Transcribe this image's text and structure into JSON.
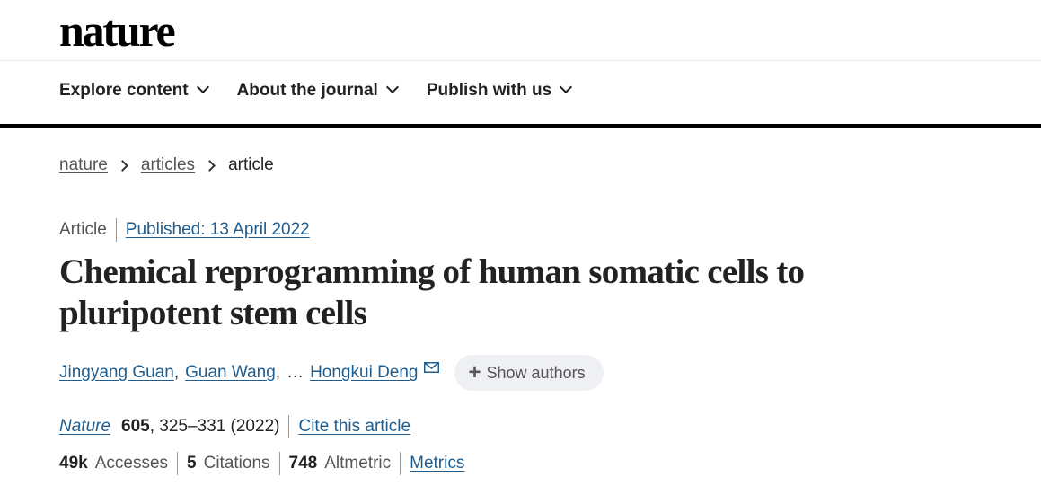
{
  "header": {
    "logo": "nature"
  },
  "nav": {
    "items": [
      {
        "label": "Explore content"
      },
      {
        "label": "About the journal"
      },
      {
        "label": "Publish with us"
      }
    ]
  },
  "breadcrumb": {
    "items": [
      "nature",
      "articles"
    ],
    "current": "article"
  },
  "article": {
    "type": "Article",
    "published": "Published: 13 April 2022",
    "title": "Chemical reprogramming of human somatic cells to pluripotent stem cells",
    "authors": [
      "Jingyang Guan",
      "Guan Wang"
    ],
    "authors_sep": ",",
    "ellipsis": "…",
    "corresponding_author": "Hongkui Deng",
    "show_authors": "Show authors",
    "citation": {
      "journal": "Nature",
      "volume": "605",
      "pages": ", 325–331 (2022)",
      "cite_label": "Cite this article"
    },
    "metrics": {
      "accesses_value": "49k",
      "accesses_label": "Accesses",
      "citations_value": "5",
      "citations_label": "Citations",
      "altmetric_value": "748",
      "altmetric_label": "Altmetric",
      "metrics_link": "Metrics"
    }
  },
  "icons": {
    "nav_chevron": "chevron-down-icon",
    "breadcrumb_separator": "chevron-right-icon",
    "mail": "envelope-icon",
    "plus": "plus-icon"
  },
  "colors": {
    "link": "#1f5d8f",
    "text": "#222222",
    "muted": "#555555",
    "button_bg": "#eef0f3"
  }
}
